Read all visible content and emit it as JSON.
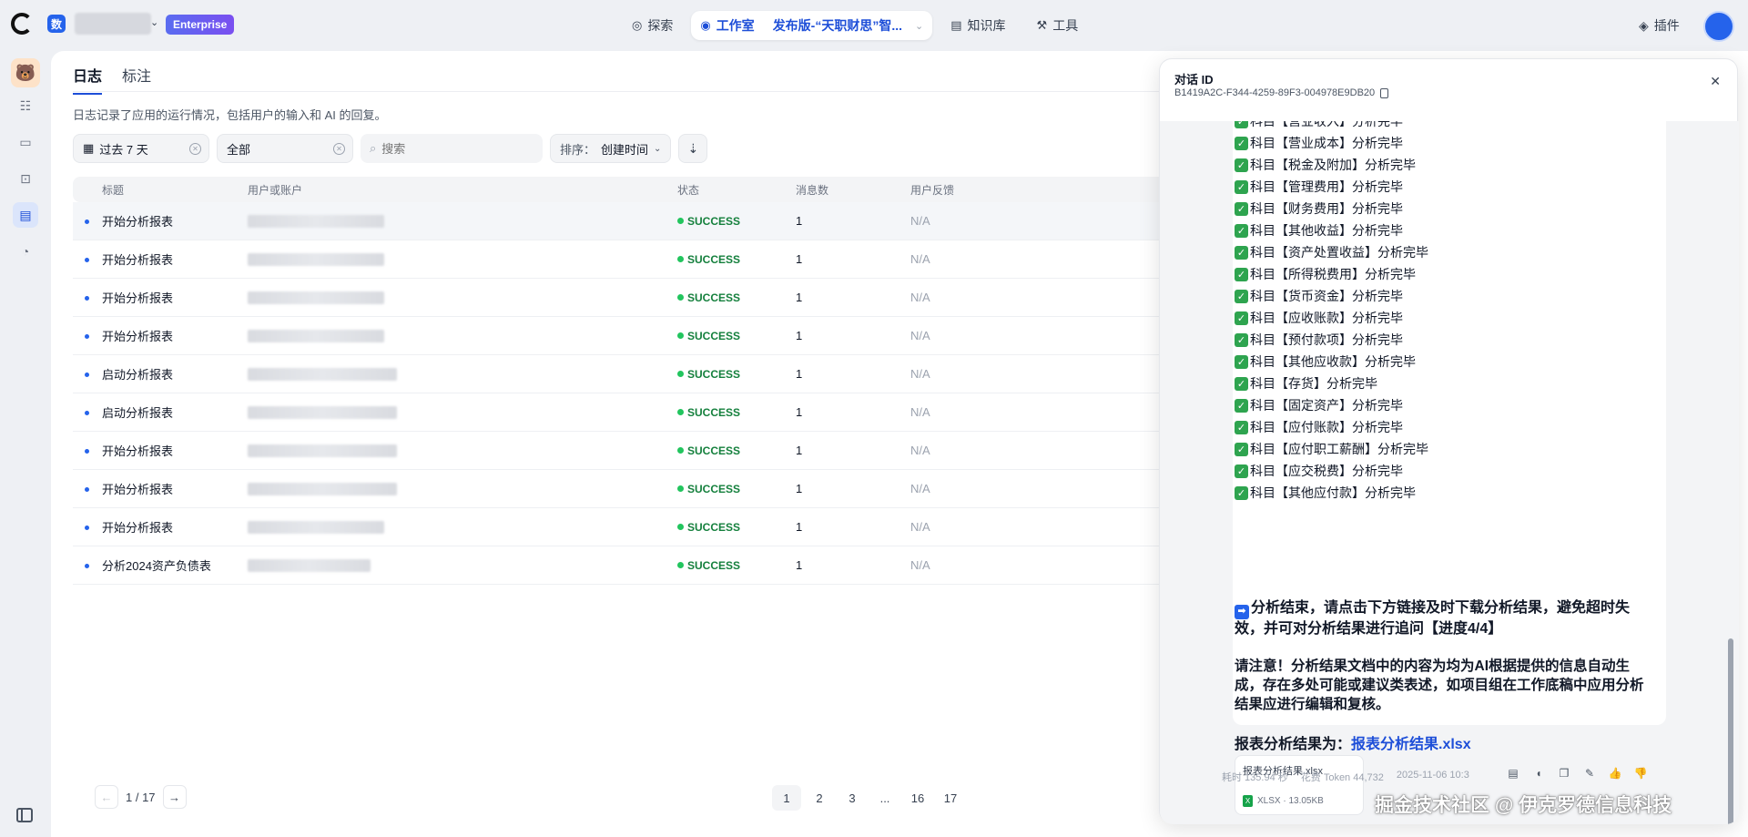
{
  "header": {
    "workspace_initial": "数",
    "plan_badge": "Enterprise",
    "nav": {
      "explore": "探索",
      "studio": "工作室",
      "app_name": "发布版-“天职财思”智...",
      "knowledge": "知识库",
      "tools": "工具"
    },
    "plugins": "插件"
  },
  "logs": {
    "tabs": [
      "日志",
      "标注"
    ],
    "description": "日志记录了应用的运行情况，包括用户的输入和 AI 的回复。",
    "filters": {
      "period": "过去 7 天",
      "status": "全部",
      "search_placeholder": "搜索",
      "sort_label": "排序：",
      "sort_value": "创建时间"
    },
    "columns": [
      "标题",
      "用户或账户",
      "状态",
      "消息数",
      "用户反馈"
    ],
    "rows": [
      {
        "title": "开始分析报表",
        "status": "SUCCESS",
        "messages": "1",
        "feedback": "N/A"
      },
      {
        "title": "开始分析报表",
        "status": "SUCCESS",
        "messages": "1",
        "feedback": "N/A"
      },
      {
        "title": "开始分析报表",
        "status": "SUCCESS",
        "messages": "1",
        "feedback": "N/A"
      },
      {
        "title": "开始分析报表",
        "status": "SUCCESS",
        "messages": "1",
        "feedback": "N/A"
      },
      {
        "title": "启动分析报表",
        "status": "SUCCESS",
        "messages": "1",
        "feedback": "N/A"
      },
      {
        "title": "启动分析报表",
        "status": "SUCCESS",
        "messages": "1",
        "feedback": "N/A"
      },
      {
        "title": "开始分析报表",
        "status": "SUCCESS",
        "messages": "1",
        "feedback": "N/A"
      },
      {
        "title": "开始分析报表",
        "status": "SUCCESS",
        "messages": "1",
        "feedback": "N/A"
      },
      {
        "title": "开始分析报表",
        "status": "SUCCESS",
        "messages": "1",
        "feedback": "N/A"
      },
      {
        "title": "分析2024资产负债表",
        "status": "SUCCESS",
        "messages": "1",
        "feedback": "N/A"
      }
    ],
    "pager": {
      "current": "1 / 17",
      "pages": [
        "1",
        "2",
        "3",
        "...",
        "16",
        "17"
      ]
    }
  },
  "drawer": {
    "title": "对话 ID",
    "conversation_id": "B1419A2C-F344-4259-89F3-004978E9DB20",
    "steps": [
      "科目【营业收入】分析完毕",
      "科目【营业成本】分析完毕",
      "科目【税金及附加】分析完毕",
      "科目【管理费用】分析完毕",
      "科目【财务费用】分析完毕",
      "科目【其他收益】分析完毕",
      "科目【资产处置收益】分析完毕",
      "科目【所得税费用】分析完毕",
      "科目【货币资金】分析完毕",
      "科目【应收账款】分析完毕",
      "科目【预付款项】分析完毕",
      "科目【其他应收款】分析完毕",
      "科目【存货】分析完毕",
      "科目【固定资产】分析完毕",
      "科目【应付账款】分析完毕",
      "科目【应付职工薪酬】分析完毕",
      "科目【应交税费】分析完毕",
      "科目【其他应付款】分析完毕"
    ],
    "finish_text": "分析结束，请点击下方链接及时下载分析结果，避免超时失效，并可对分析结果进行追问【进度4/4】",
    "notice_text": "请注意！分析结果文档中的内容为均为AI根据提供的信息自动生成，存在多处可能或建议类表述，如项目组在工作底稿中应用分析结果应进行编辑和复核。",
    "result_label": "报表分析结果为：",
    "result_link": "报表分析结果.xlsx",
    "file": {
      "name": "报表分析结果.xlsx",
      "meta": "XLSX · 13.05KB",
      "icon_letter": "X"
    },
    "footer": {
      "elapsed": "耗时 135.94 秒",
      "tokens": "花费 Token 44,732",
      "time": "2025-11-06 10:3"
    }
  },
  "watermark": "掘金技术社区 @ 伊克罗德信息科技"
}
